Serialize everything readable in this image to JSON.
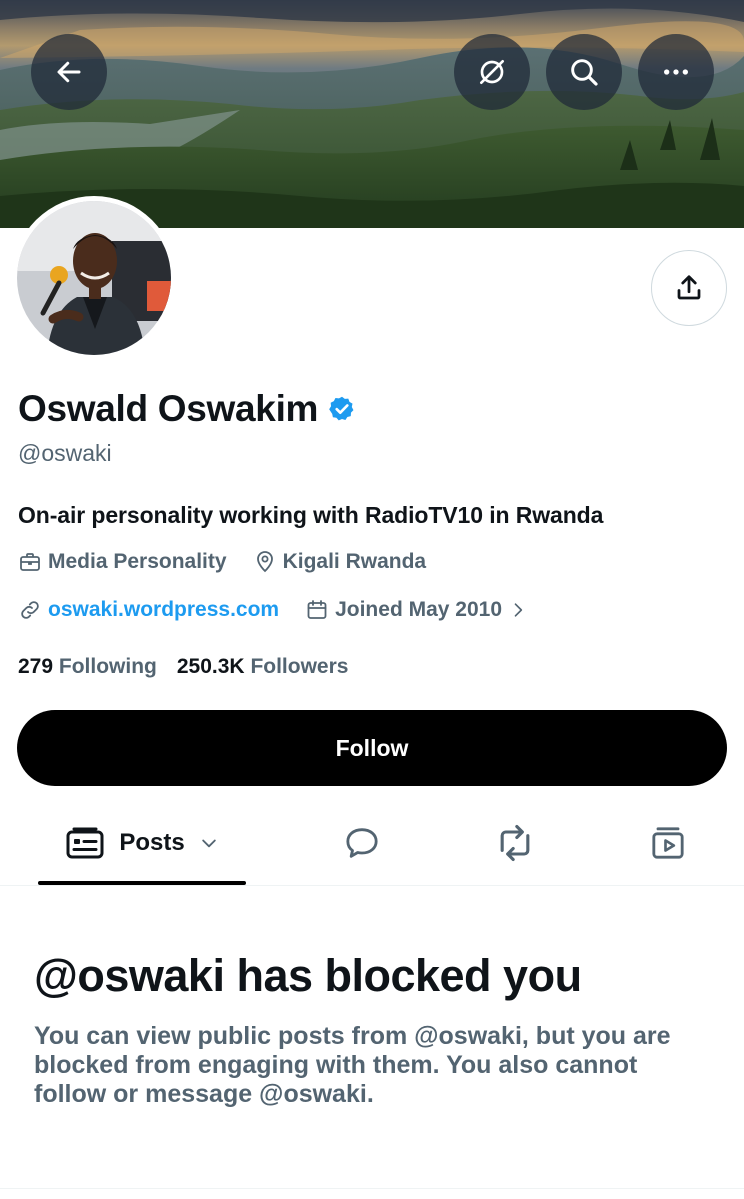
{
  "profile": {
    "display_name": "Oswald Oswakim",
    "handle": "@oswaki",
    "bio": "On-air personality working with RadioTV10 in Rwanda",
    "category": "Media Personality",
    "location": "Kigali Rwanda",
    "website": "oswaki.wordpress.com",
    "joined": "Joined May 2010",
    "following_count": "279",
    "following_label": "Following",
    "followers_count": "250.3K",
    "followers_label": "Followers",
    "verified": true
  },
  "actions": {
    "follow_label": "Follow"
  },
  "tabs": [
    {
      "label": "Posts",
      "icon": "posts-icon",
      "selected": true
    },
    {
      "label": "",
      "icon": "replies-icon",
      "selected": false
    },
    {
      "label": "",
      "icon": "reposts-icon",
      "selected": false
    },
    {
      "label": "",
      "icon": "media-icon",
      "selected": false
    }
  ],
  "header_icons": [
    "back-arrow-icon",
    "translate-icon",
    "search-icon",
    "more-icon"
  ],
  "blocked": {
    "title": "@oswaki has blocked you",
    "message": "You can view public posts from @oswaki, but you are blocked from engaging with them. You also cannot follow or message @oswaki."
  },
  "colors": {
    "accent": "#1d9bf0",
    "text_primary": "#0f1419",
    "text_secondary": "#536471",
    "follow_bg": "#000000"
  }
}
